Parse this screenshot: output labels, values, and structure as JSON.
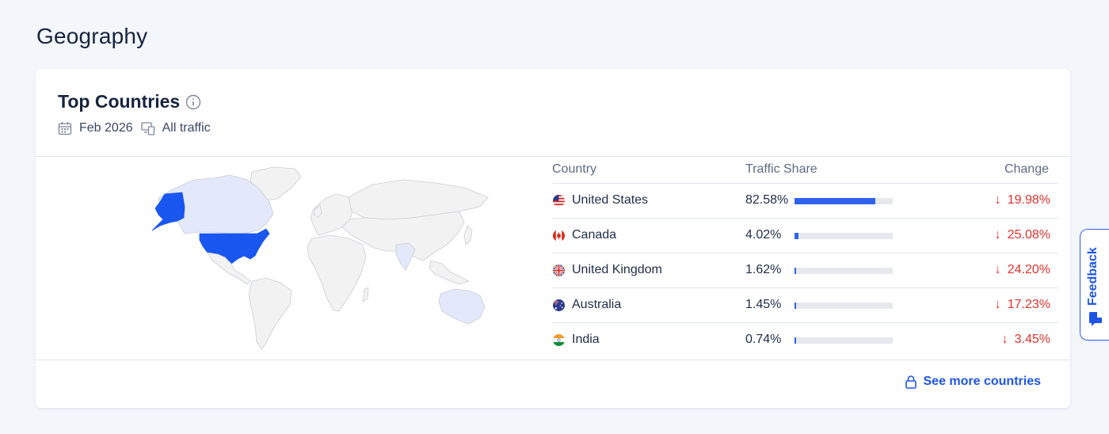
{
  "page": {
    "title": "Geography"
  },
  "card": {
    "title": "Top Countries",
    "date": "Feb 2026",
    "traffic": "All traffic"
  },
  "table": {
    "headers": {
      "country": "Country",
      "share": "Traffic Share",
      "change": "Change"
    },
    "rows": [
      {
        "country": "United States",
        "share": "82.58%",
        "share_value": 82.58,
        "change": "19.98%",
        "direction": "down",
        "flag": "us-flag"
      },
      {
        "country": "Canada",
        "share": "4.02%",
        "share_value": 4.02,
        "change": "25.08%",
        "direction": "down",
        "flag": "ca-flag"
      },
      {
        "country": "United Kingdom",
        "share": "1.62%",
        "share_value": 1.62,
        "change": "24.20%",
        "direction": "down",
        "flag": "uk-flag"
      },
      {
        "country": "Australia",
        "share": "1.45%",
        "share_value": 1.45,
        "change": "17.23%",
        "direction": "down",
        "flag": "au-flag"
      },
      {
        "country": "India",
        "share": "0.74%",
        "share_value": 0.74,
        "change": "3.45%",
        "direction": "down",
        "flag": "in-flag"
      }
    ]
  },
  "links": {
    "see_more": "See more countries"
  },
  "feedback": {
    "label": "Feedback"
  },
  "colors": {
    "accent": "#1e55e5",
    "bar": "#2f63ee",
    "negative": "#e4322b",
    "map_highlight": "#1a56f0",
    "map_light": "#e3e9fa",
    "map_base": "#f2f2f2"
  }
}
